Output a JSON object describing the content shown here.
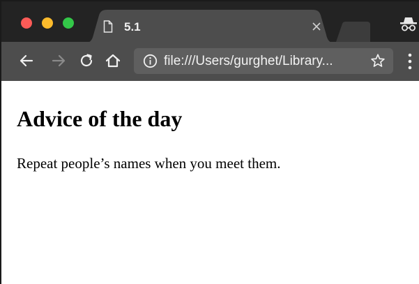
{
  "browser": {
    "tab": {
      "title": "5.1",
      "icons": {
        "page": "document-icon",
        "close": "close-icon"
      }
    },
    "toolbar": {
      "icons": {
        "back": "back-arrow-icon",
        "forward": "forward-arrow-icon",
        "reload": "reload-icon",
        "home": "home-icon",
        "info": "info-icon",
        "bookmark": "star-icon",
        "menu": "kebab-menu-icon",
        "incognito": "incognito-icon"
      },
      "address": "file:///Users/gurghet/Library..."
    },
    "colors": {
      "tabstrip": "#232323",
      "active_tab": "#4d4d4d",
      "omnibox": "#5f5f5f",
      "close_red": "#fc5b57",
      "minimize_yellow": "#fcbb2c",
      "zoom_green": "#33c748"
    }
  },
  "page": {
    "heading": "Advice of the day",
    "advice": "Repeat people’s names when you meet them."
  }
}
